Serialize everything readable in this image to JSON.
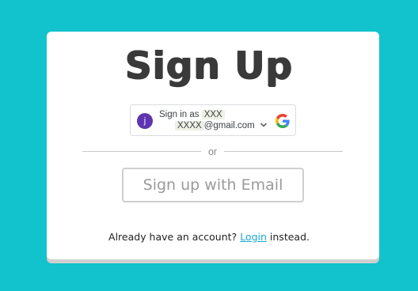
{
  "page": {
    "title": "Sign Up"
  },
  "google_signin": {
    "line1_prefix": "Sign in as",
    "line1_name": "XXX",
    "line2_name": "XXXX",
    "line2_domain": "@gmail.com",
    "avatar_letter": "j",
    "icons": [
      "chevron-down-icon",
      "google-logo-icon"
    ]
  },
  "divider": {
    "label": "or"
  },
  "email_signup": {
    "label": "Sign up with Email"
  },
  "login_prompt": {
    "prefix": "Already have an account?",
    "link": "Login",
    "suffix": "instead."
  },
  "colors": {
    "background": "#12c3cd",
    "card": "#ffffff",
    "title": "#3a3a3a",
    "link": "#1aa8d1",
    "avatar": "#5e35b1"
  }
}
